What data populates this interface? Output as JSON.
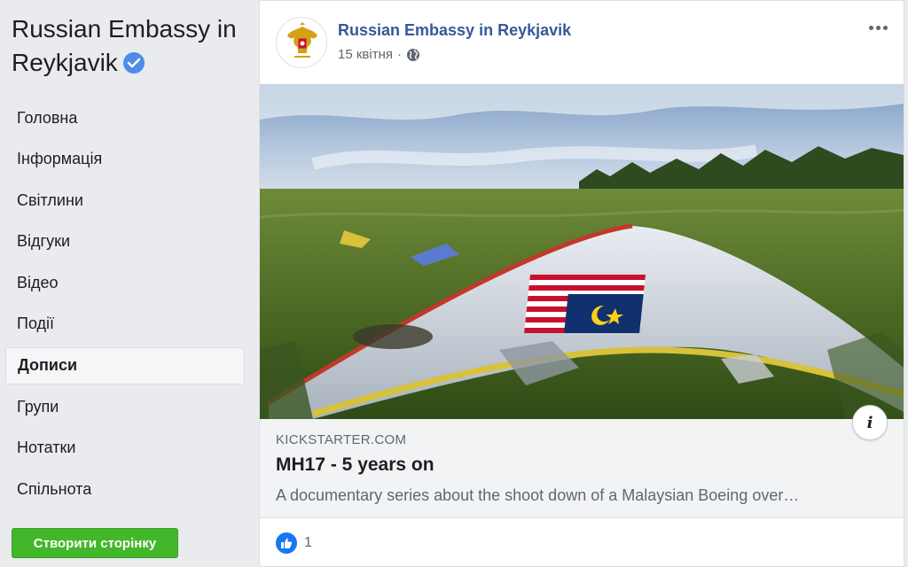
{
  "sidebar": {
    "page_title": "Russian Embassy in Reykjavik",
    "items": [
      {
        "label": "Головна"
      },
      {
        "label": "Інформація"
      },
      {
        "label": "Світлини"
      },
      {
        "label": "Відгуки"
      },
      {
        "label": "Відео"
      },
      {
        "label": "Події"
      },
      {
        "label": "Дописи",
        "active": true
      },
      {
        "label": "Групи"
      },
      {
        "label": "Нотатки"
      },
      {
        "label": "Спільнота"
      }
    ],
    "create_page_label": "Створити сторінку"
  },
  "post": {
    "author": "Russian Embassy in Reykjavik",
    "date": "15 квітня",
    "separator": "·",
    "privacy_icon": "globe-icon",
    "link": {
      "domain": "KICKSTARTER.COM",
      "title": "MH17 - 5 years on",
      "description": "A documentary series about the shoot down of a Malaysian Boeing over…",
      "info_label": "i"
    },
    "reactions": {
      "icon": "like-icon",
      "count": "1"
    }
  },
  "colors": {
    "link_blue": "#385898",
    "create_green": "#42b72a",
    "like_blue": "#1877f2",
    "verified_blue": "#4f8be8"
  }
}
